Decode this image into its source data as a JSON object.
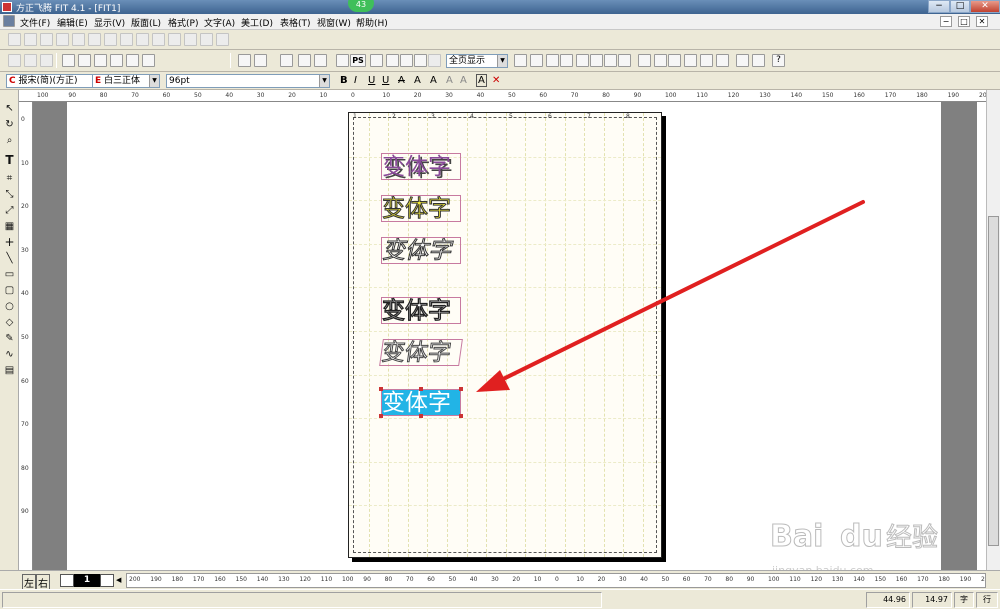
{
  "window": {
    "title": "方正飞腾 FIT 4.1 - [FIT1]",
    "badge": "43",
    "minimize": "−",
    "maximize": "□",
    "close": "✕"
  },
  "menu": [
    "文件(F)",
    "编辑(E)",
    "显示(V)",
    "版面(L)",
    "格式(P)",
    "文字(A)",
    "美工(D)",
    "表格(T)",
    "视窗(W)",
    "帮助(H)"
  ],
  "toolbar2": {
    "zoom": "全页显示",
    "ps_label": "PS"
  },
  "toolbar3": {
    "color_letter": "C",
    "font_cn": "报宋(简)(方正)",
    "e_letter": "E",
    "font_en": "白三正体",
    "size": "96pt",
    "styles": [
      "B",
      "I",
      "U",
      "U",
      "A",
      "A",
      "A",
      "A",
      "A",
      "A",
      "✕"
    ]
  },
  "ruler": {
    "h_ticks": [
      "100",
      "90",
      "80",
      "70",
      "60",
      "50",
      "40",
      "30",
      "20",
      "10",
      "0",
      "10",
      "20",
      "30",
      "40",
      "50",
      "60",
      "70",
      "80",
      "90",
      "100",
      "110",
      "120",
      "130",
      "140",
      "150",
      "160",
      "170",
      "180",
      "190",
      "200"
    ],
    "v_ticks": [
      "0",
      "10",
      "20",
      "30",
      "40",
      "50",
      "60",
      "70",
      "80",
      "90"
    ],
    "page_ticks": [
      "1",
      "2",
      "3",
      "4",
      "5",
      "6",
      "7",
      "8"
    ],
    "bottom_ticks": [
      "200",
      "190",
      "180",
      "170",
      "160",
      "150",
      "140",
      "130",
      "120",
      "110",
      "100",
      "90",
      "80",
      "70",
      "60",
      "50",
      "40",
      "30",
      "20",
      "10",
      "0",
      "10",
      "20",
      "30",
      "40",
      "50",
      "60",
      "70",
      "80",
      "90",
      "100",
      "110",
      "120",
      "130",
      "140",
      "150",
      "160",
      "170",
      "180",
      "190",
      "200"
    ]
  },
  "samples": [
    {
      "text": "变体字",
      "style": "shadow",
      "color": "#8a4a9a"
    },
    {
      "text": "变体字",
      "style": "yellow-fill",
      "color": "#f3ea3a"
    },
    {
      "text": "变体字",
      "style": "italic-outline",
      "color": "#333333"
    },
    {
      "text": "变体字",
      "style": "bold-outline",
      "color": "#222222"
    },
    {
      "text": "变体字",
      "style": "skewed",
      "color": "#444444"
    },
    {
      "text": "变体字",
      "style": "selected",
      "color": "#ffffff",
      "highlight": "#22b4e6"
    }
  ],
  "bottom": {
    "left_label": "左",
    "right_label": "右",
    "page_number": "1"
  },
  "status": {
    "x": "44.96",
    "y": "14.97",
    "unit": "字",
    "mode": "行"
  },
  "watermark": {
    "brand": "Bai",
    "brand2": "du",
    "product": "经验",
    "url": "jingyan.baidu.com"
  }
}
